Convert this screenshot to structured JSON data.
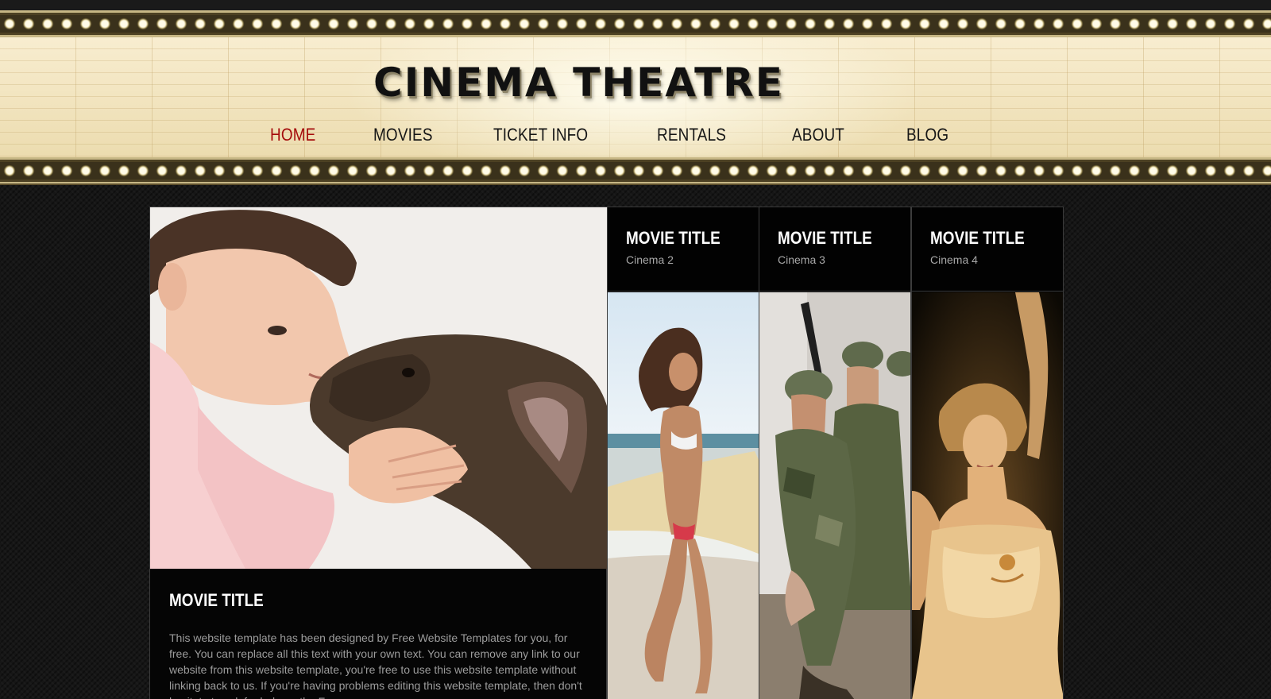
{
  "site": {
    "title": "CINEMA THEATRE"
  },
  "nav": {
    "items": [
      {
        "label": "HOME",
        "active": true
      },
      {
        "label": "MOVIES",
        "active": false
      },
      {
        "label": "TICKET INFO",
        "active": false
      },
      {
        "label": "RENTALS",
        "active": false
      },
      {
        "label": "ABOUT",
        "active": false
      },
      {
        "label": "BLOG",
        "active": false
      }
    ]
  },
  "feature": {
    "title": "MOVIE TITLE",
    "text": "This website template has been designed by Free Website Templates for you, for free. You can replace all this text with your own text. You can remove any link to our website from this website template, you're free to use this website template without linking back to us. If you're having problems editing this website template, then don't hesitate to ask for help on the Forums."
  },
  "cinemas": [
    {
      "title": "MOVIE TITLE",
      "subtitle": "Cinema 2"
    },
    {
      "title": "MOVIE TITLE",
      "subtitle": "Cinema 3"
    },
    {
      "title": "MOVIE TITLE",
      "subtitle": "Cinema 4"
    }
  ],
  "colors": {
    "nav_active": "#a50c0c",
    "page_background": "#161616",
    "marquee": "#f4e7c4"
  }
}
